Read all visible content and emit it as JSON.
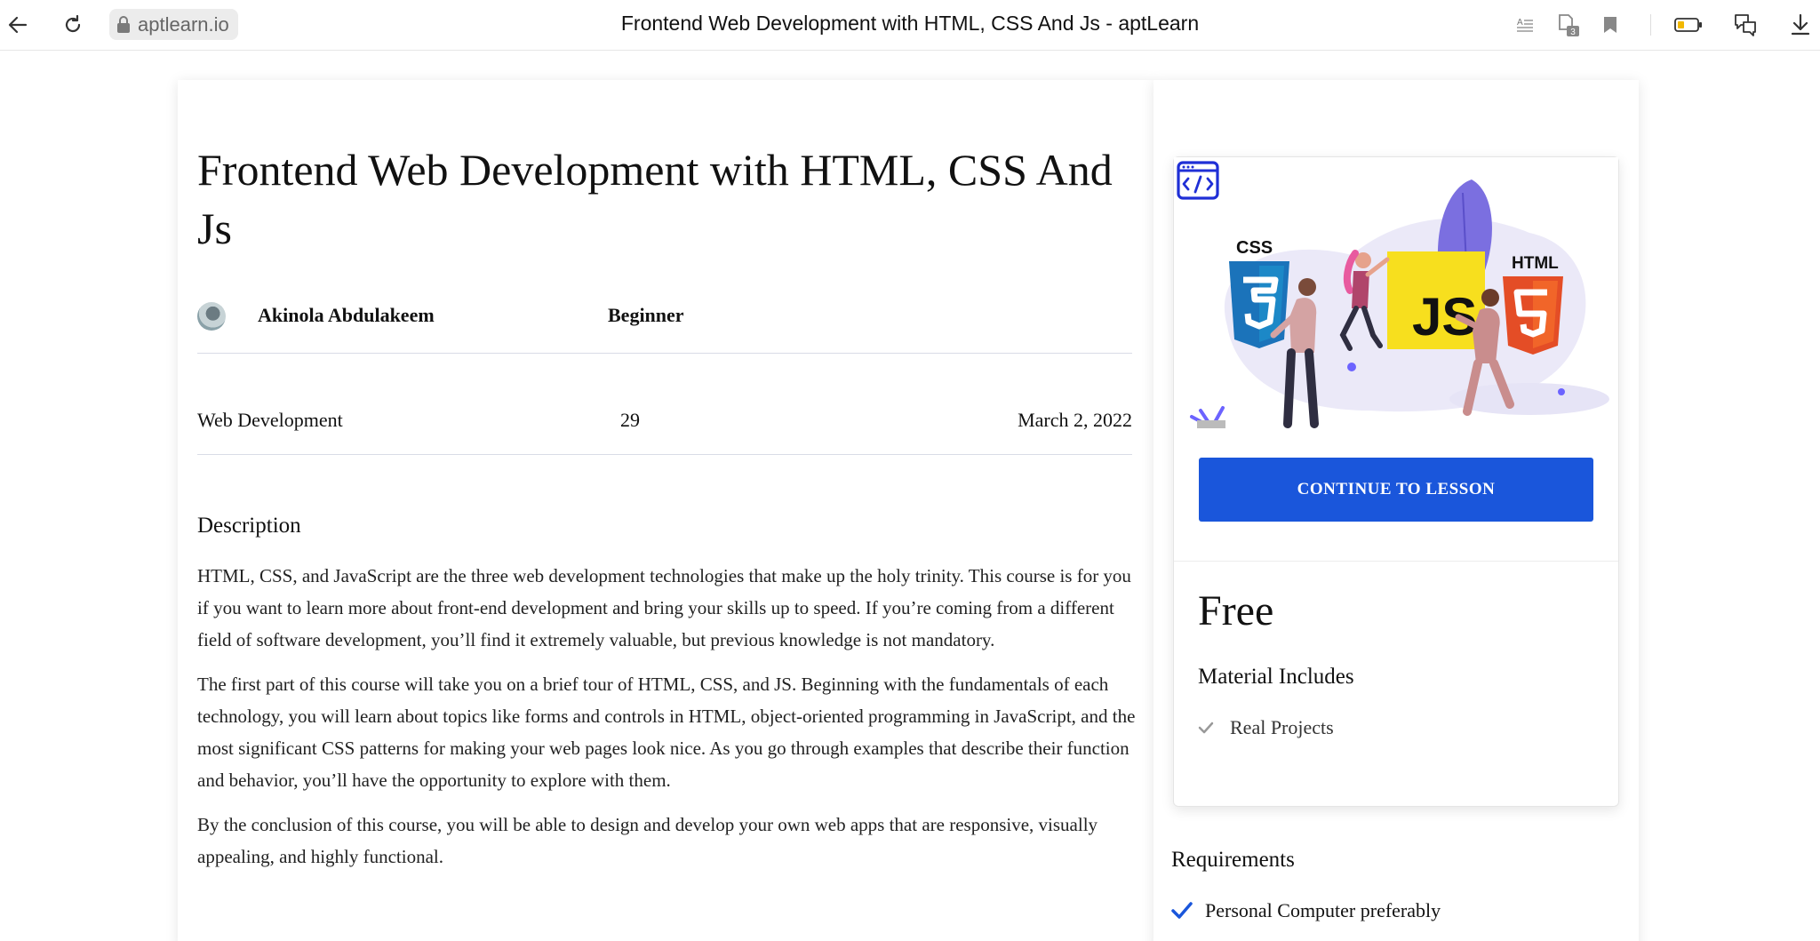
{
  "browser": {
    "url": "aptlearn.io",
    "tab_title": "Frontend Web Development with HTML, CSS And Js - aptLearn",
    "tab_count": "3"
  },
  "course": {
    "title": "Frontend Web Development with HTML, CSS And Js",
    "author": "Akinola Abdulakeem",
    "level": "Beginner",
    "category": "Web Development",
    "lessons": "29",
    "date": "March 2, 2022",
    "description_heading": "Description",
    "description": [
      "HTML, CSS, and JavaScript are the three web development technologies that make up the holy trinity. This course is for you if you want to learn more about front-end development and bring your skills up to speed. If you’re coming from a different field of software development, you’ll find it extremely valuable, but previous knowledge is not mandatory.",
      "The first part of this course will take you on a brief tour of HTML, CSS, and JS. Beginning with the fundamentals of each technology, you will learn about topics like forms and controls in HTML, object-oriented programming in JavaScript, and the most significant CSS patterns for making your web pages look nice. As you go through examples that describe their function and behavior, you’ll have the opportunity to explore with them.",
      "By the conclusion of this course, you will be able to design and develop your own web apps that are responsive, visually appealing, and highly functional."
    ]
  },
  "sidebar": {
    "thumbnail": {
      "css_label": "CSS",
      "js_label": "JS",
      "html_label": "HTML"
    },
    "continue_label": "CONTINUE TO LESSON",
    "price": "Free",
    "material_heading": "Material Includes",
    "materials": [
      "Real Projects"
    ],
    "requirements_heading": "Requirements",
    "requirements": [
      "Personal Computer preferably"
    ]
  },
  "colors": {
    "accent": "#1a56db",
    "js_yellow": "#f7df1e",
    "html_orange": "#e44d26",
    "css_blue": "#1b73ba",
    "illustration_purple": "#6c63ff"
  }
}
